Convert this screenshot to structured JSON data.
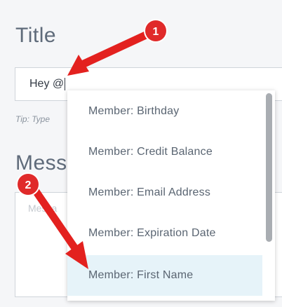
{
  "form": {
    "title_label": "Title",
    "title_value": "Hey @",
    "tip_text": "Tip: Type",
    "message_label": "Mess",
    "message_placeholder": "Messa"
  },
  "dropdown": {
    "items": [
      {
        "label": "Member: Birthday",
        "highlighted": false
      },
      {
        "label": "Member: Credit Balance",
        "highlighted": false
      },
      {
        "label": "Member: Email Address",
        "highlighted": false
      },
      {
        "label": "Member: Expiration Date",
        "highlighted": false
      },
      {
        "label": "Member: First Name",
        "highlighted": true
      }
    ]
  },
  "annotations": {
    "badge_1": "1",
    "badge_2": "2",
    "badge_color": "#e02a2a",
    "arrow_color": "#e3211f"
  },
  "colors": {
    "label_text": "#5f6b7a",
    "item_text": "#5a6572",
    "highlight_bg": "#e6f3f9",
    "border": "#cfd4da"
  }
}
